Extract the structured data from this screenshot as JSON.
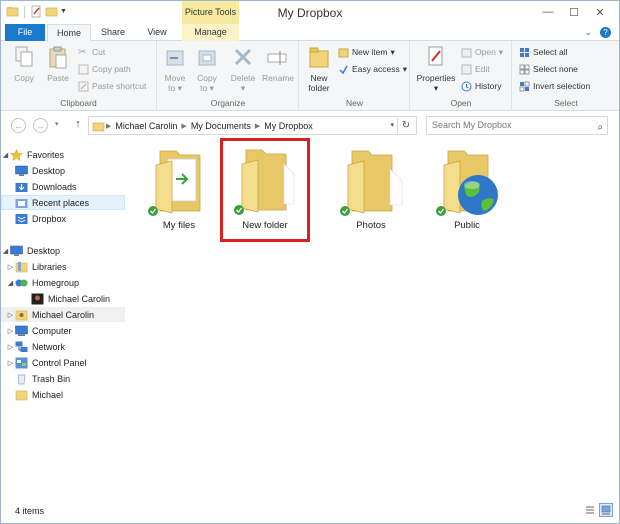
{
  "window": {
    "title": "My Dropbox",
    "contextual_tab": "Picture Tools"
  },
  "tabs": [
    {
      "label": "File"
    },
    {
      "label": "Home"
    },
    {
      "label": "Share"
    },
    {
      "label": "View"
    },
    {
      "label": "Manage"
    }
  ],
  "ribbon": {
    "clipboard": {
      "label": "Clipboard",
      "copy": "Copy",
      "paste": "Paste",
      "cut": "Cut",
      "copy_path": "Copy path",
      "paste_shortcut": "Paste shortcut"
    },
    "organize": {
      "label": "Organize",
      "move_to": "Move",
      "move_to2": "to",
      "copy_to": "Copy",
      "copy_to2": "to",
      "delete": "Delete",
      "rename": "Rename"
    },
    "new": {
      "label": "New",
      "new_folder": "New",
      "new_folder2": "folder",
      "new_item": "New item",
      "easy_access": "Easy access"
    },
    "open": {
      "label": "Open",
      "properties": "Properties",
      "open": "Open",
      "edit": "Edit",
      "history": "History"
    },
    "select": {
      "label": "Select",
      "select_all": "Select all",
      "select_none": "Select none",
      "invert": "Invert selection"
    }
  },
  "address": {
    "crumbs": [
      "Michael Carolin",
      "My Documents",
      "My Dropbox"
    ],
    "search_placeholder": "Search My Dropbox"
  },
  "nav": {
    "favorites": "Favorites",
    "desktop_fav": "Desktop",
    "downloads": "Downloads",
    "recent": "Recent places",
    "dropbox": "Dropbox",
    "desktop": "Desktop",
    "libraries": "Libraries",
    "homegroup": "Homegroup",
    "hg_user": "Michael Carolin",
    "user": "Michael Carolin",
    "computer": "Computer",
    "network": "Network",
    "control_panel": "Control Panel",
    "trash": "Trash Bin",
    "michael": "Michael"
  },
  "items": [
    {
      "name": "My files"
    },
    {
      "name": "New folder"
    },
    {
      "name": "Photos"
    },
    {
      "name": "Public"
    }
  ],
  "status": {
    "count": "4 items"
  },
  "colors": {
    "accent": "#1979ca",
    "highlight": "#d82020",
    "sync_green": "#3aa13a",
    "folder": "#f2d57a"
  }
}
